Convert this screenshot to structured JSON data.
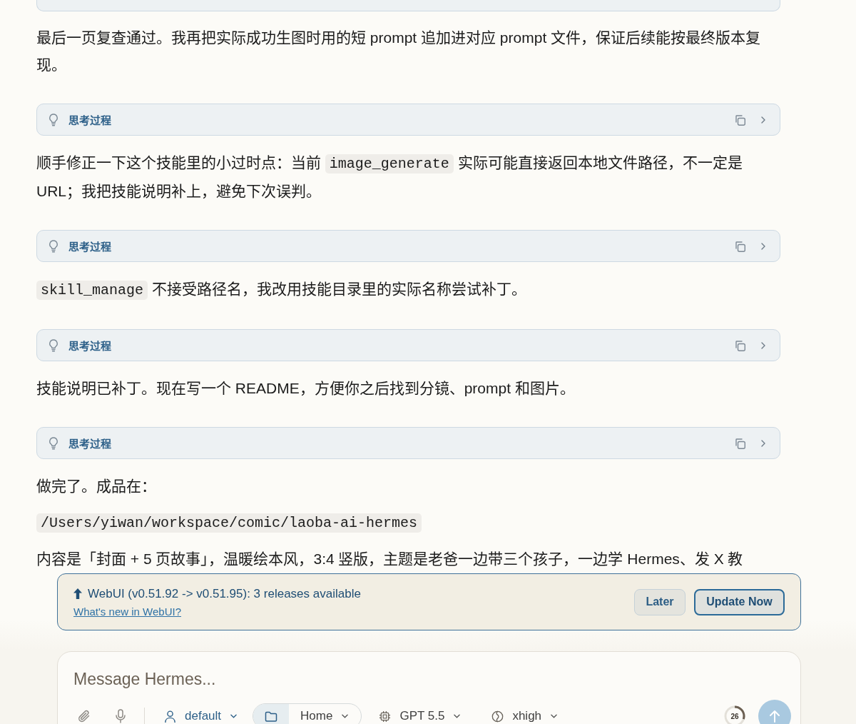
{
  "messages": [
    {
      "kind": "thinking_edge"
    },
    {
      "kind": "text",
      "parts": [
        {
          "kind": "plain",
          "text": "最后一页复查通过。我再把实际成功生图时用的短 prompt 追加进对应 prompt 文件，保证后续能按最终版本复现。"
        }
      ]
    },
    {
      "kind": "thinking",
      "label": "思考过程",
      "expanded": false
    },
    {
      "kind": "text",
      "parts": [
        {
          "kind": "plain",
          "text": "顺手修正一下这个技能里的小过时点：当前 "
        },
        {
          "kind": "code",
          "text": "image_generate"
        },
        {
          "kind": "plain",
          "text": " 实际可能直接返回本地文件路径，不一定是 URL；我把技能说明补上，避免下次误判。"
        }
      ]
    },
    {
      "kind": "thinking",
      "label": "思考过程",
      "expanded": false
    },
    {
      "kind": "text",
      "parts": [
        {
          "kind": "code",
          "text": "skill_manage"
        },
        {
          "kind": "plain",
          "text": " 不接受路径名，我改用技能目录里的实际名称尝试补丁。"
        }
      ]
    },
    {
      "kind": "thinking",
      "label": "思考过程",
      "expanded": false
    },
    {
      "kind": "text",
      "parts": [
        {
          "kind": "plain",
          "text": "技能说明已补丁。现在写一个 README，方便你之后找到分镜、prompt 和图片。"
        }
      ]
    },
    {
      "kind": "thinking",
      "label": "思考过程",
      "expanded": false
    },
    {
      "kind": "text",
      "parts": [
        {
          "kind": "plain",
          "text": "做完了。成品在："
        }
      ]
    },
    {
      "kind": "code_line",
      "text": "/Users/yiwan/workspace/comic/laoba-ai-hermes"
    },
    {
      "kind": "text",
      "parts": [
        {
          "kind": "plain",
          "text": "内容是「封面 + 5 页故事」，温暖绘本风，3:4 竖版，主题是老爸一边带三个孩子，一边学 Hermes、发 X 教"
        }
      ]
    }
  ],
  "update_banner": {
    "title": "WebUI (v0.51.92 -> v0.51.95): 3 releases available",
    "link": "What's new in WebUI?",
    "buttons": [
      {
        "label": "Later",
        "kind": "secondary"
      },
      {
        "label": "Update Now",
        "kind": "primary"
      }
    ]
  },
  "composer": {
    "placeholder": "Message Hermes...",
    "profile": "default",
    "folder": "Home",
    "model": "GPT 5.5",
    "reasoning": "xhigh",
    "context": {
      "reading": "26",
      "level": 0.3
    },
    "send": {
      "disabled": true
    }
  }
}
